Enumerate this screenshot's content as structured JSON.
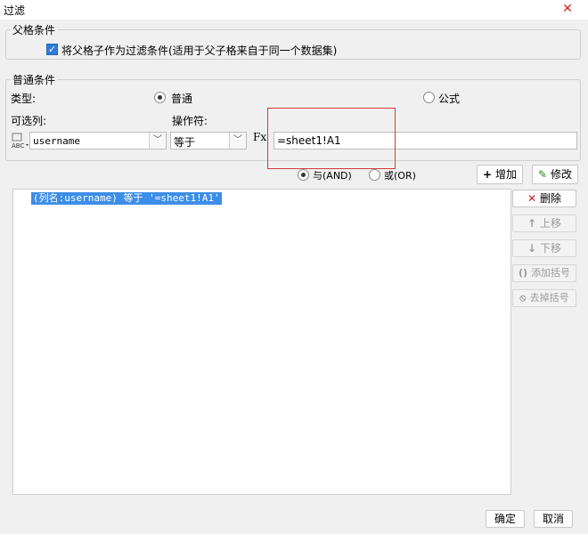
{
  "window": {
    "title": "过滤",
    "close_glyph": "✕"
  },
  "parent_condition": {
    "legend": "父格条件",
    "checkbox_checked": true,
    "checkbox_label": "将父格子作为过滤条件(适用于父子格来自于同一个数据集)"
  },
  "normal_condition": {
    "legend": "普通条件",
    "type_label": "类型:",
    "type_options": [
      {
        "label": "普通",
        "selected": true
      },
      {
        "label": "公式",
        "selected": false
      }
    ],
    "column_label": "可选列:",
    "operator_label": "操作符:",
    "column_value": "username",
    "operator_value": "等于",
    "formula_icon": "Fx",
    "value_text": "=sheet1!A1",
    "logic_options": [
      {
        "label": "与(AND)",
        "selected": true
      },
      {
        "label": "或(OR)",
        "selected": false
      }
    ],
    "add_button": "增加",
    "modify_button": "修改"
  },
  "condition_list": [
    {
      "text": "(列名:username) 等于 '=sheet1!A1'",
      "selected": true
    }
  ],
  "side_buttons": {
    "delete": "删除",
    "move_up": "上移",
    "move_down": "下移",
    "add_bracket": "添加括号",
    "remove_bracket": "去掉括号"
  },
  "footer": {
    "ok": "确定",
    "cancel": "取消"
  },
  "colors": {
    "accent": "#2f7bd6",
    "selection": "#3c8ee8",
    "highlight_box": "#d03a3a",
    "delete_icon": "#d02020"
  }
}
